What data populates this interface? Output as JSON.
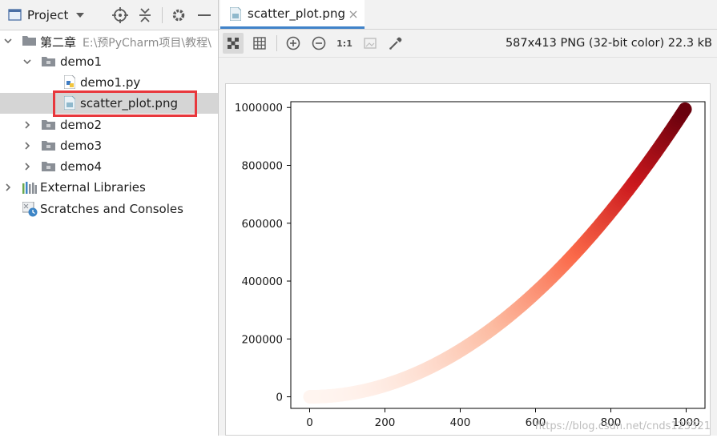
{
  "project_panel": {
    "title": "Project",
    "tree": {
      "root": {
        "name": "第二章",
        "path": "E:\\预PyCharm项目\\教程\\"
      },
      "demo1": "demo1",
      "demo1_py": "demo1.py",
      "scatter_png": "scatter_plot.png",
      "demo2": "demo2",
      "demo3": "demo3",
      "demo4": "demo4",
      "external_libraries": "External Libraries",
      "scratches": "Scratches and Consoles"
    }
  },
  "editor": {
    "tab_title": "scatter_plot.png",
    "toolbar": {
      "actual_size_label": "1:1"
    },
    "image_info": "587x413 PNG (32-bit color) 22.3 kB"
  },
  "chart_data": {
    "type": "scatter",
    "colormap": "Reds",
    "x_range": [
      1,
      1000
    ],
    "function": "y = x^2",
    "x": [
      0,
      100,
      200,
      300,
      400,
      500,
      600,
      700,
      800,
      900,
      1000
    ],
    "y": [
      0,
      10000,
      40000,
      90000,
      160000,
      250000,
      360000,
      490000,
      640000,
      810000,
      1000000
    ],
    "xlim": [
      -50,
      1050
    ],
    "ylim": [
      -40000,
      1020000
    ],
    "x_ticks": [
      0,
      200,
      400,
      600,
      800,
      1000
    ],
    "y_ticks": [
      0,
      200000,
      400000,
      600000,
      800000,
      1000000
    ],
    "x_tick_labels": [
      "0",
      "200",
      "400",
      "600",
      "800",
      "1000"
    ],
    "y_tick_labels": [
      "0",
      "200000",
      "400000",
      "600000",
      "800000",
      "1000000"
    ],
    "title": "",
    "xlabel": "",
    "ylabel": ""
  },
  "watermark": "https://blog.csdn.net/cnds123321"
}
